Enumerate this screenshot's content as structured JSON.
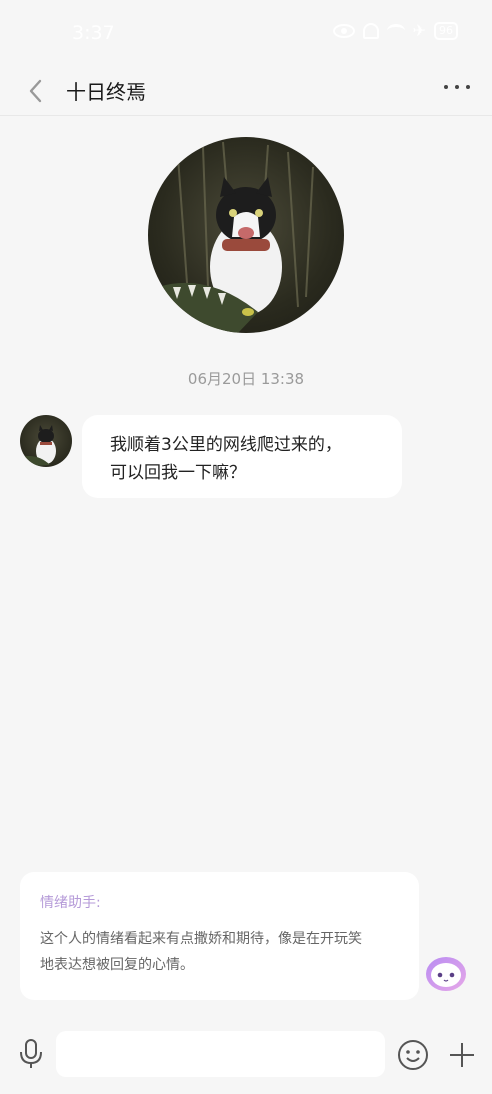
{
  "status_bar": {
    "time": "3:37",
    "battery": "96"
  },
  "header": {
    "title": "十日终焉"
  },
  "chat": {
    "timestamp": "06月20日 13:38",
    "message_lines": [
      "我顺着3公里的网线爬过来的，",
      "可以回我一下嘛？"
    ]
  },
  "assistant": {
    "title": "情绪助手:",
    "text_lines": [
      "这个人的情绪看起来有点撒娇和期待，像是在开玩笑",
      "地表达想被回复的心情。"
    ]
  },
  "input": {
    "value": "",
    "placeholder": ""
  },
  "colors": {
    "background": "#f6f6f6",
    "bubble": "#ffffff",
    "assistant_title": "#b59ad8",
    "bot_icon": "#c9a8f0"
  }
}
